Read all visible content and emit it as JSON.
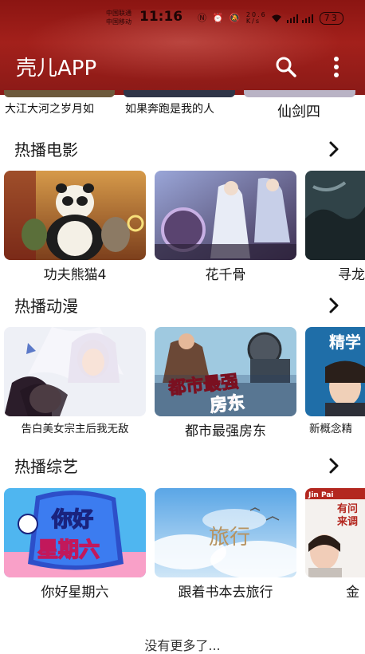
{
  "status_bar": {
    "carrier_1": "中国联通",
    "carrier_2": "中国移动",
    "time": "11:16",
    "speed": "20.6",
    "speed_unit": "K/s",
    "battery": "73"
  },
  "header": {
    "title": "壳儿APP"
  },
  "top_row": {
    "captions": [
      "大江大河之岁月如",
      "如果奔跑是我的人",
      "仙剑四"
    ]
  },
  "sections": [
    {
      "title": "热播电影",
      "items": [
        {
          "title": "功夫熊猫4"
        },
        {
          "title": "花千骨"
        },
        {
          "title": "寻龙"
        }
      ]
    },
    {
      "title": "热播动漫",
      "items": [
        {
          "title": "告白美女宗主后我无敌"
        },
        {
          "title": "都市最强房东"
        },
        {
          "title": "新概念精"
        }
      ]
    },
    {
      "title": "热播综艺",
      "items": [
        {
          "title": "你好星期六"
        },
        {
          "title": "跟着书本去旅行"
        },
        {
          "title": "金"
        }
      ]
    }
  ],
  "poster_text": {
    "city_landlord_line1": "都市最强",
    "city_landlord_line2": "房东",
    "jing_xue": "精学",
    "hello_sat_top": "你好",
    "hello_sat_bottom": "星期六",
    "travel": "旅行",
    "jinpai": "Jin Pai",
    "jinpai_line1": "有问",
    "jinpai_line2": "来调"
  },
  "footer": {
    "text": "没有更多了..."
  }
}
